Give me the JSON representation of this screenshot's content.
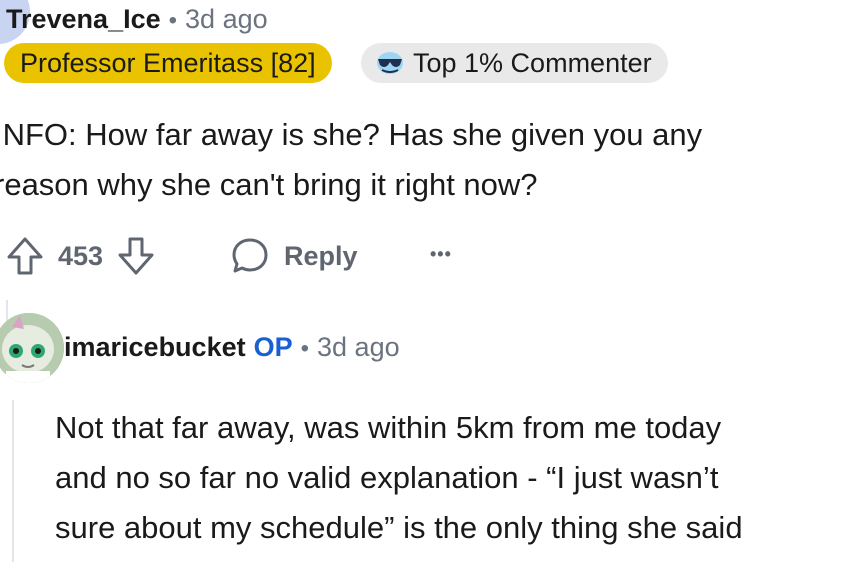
{
  "comment1": {
    "username": "Trevena_Ice",
    "time": "3d ago",
    "flair": "Professor Emeritass [82]",
    "badge": "Top 1% Commenter",
    "text_line1": "INFO: How far away is she? Has she given you any",
    "text_line2": "reason why she can't bring it right now?",
    "votes": "453",
    "reply_label": "Reply",
    "more_label": "•••"
  },
  "comment2": {
    "username": "imaricebucket",
    "op_label": "OP",
    "time": "3d ago",
    "text_line1": "Not that far away, was within 5km from me today",
    "text_line2": "and no so far no valid explanation - “I just wasn’t",
    "text_line3": "sure about my schedule” is the only thing she said"
  },
  "colors": {
    "flair_bg": "#e9c300",
    "badge_bg": "#e9e9ea",
    "op_blue": "#1a5fd1",
    "meta_gray": "#6b7280"
  },
  "icons": [
    "upvote-icon",
    "downvote-icon",
    "reply-bubble-icon",
    "more-icon",
    "sunglasses-icon"
  ]
}
